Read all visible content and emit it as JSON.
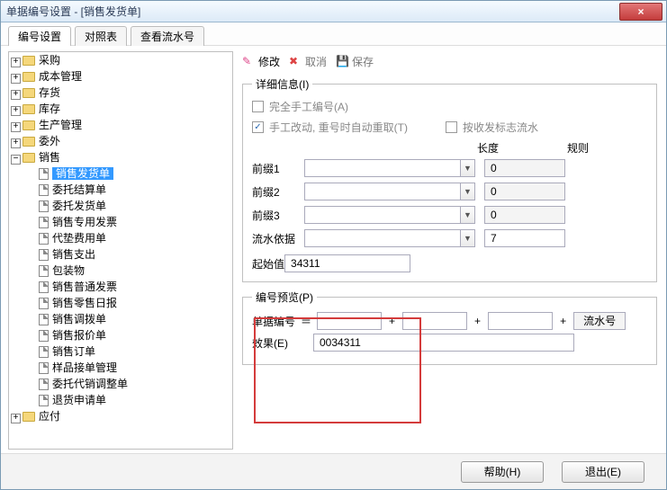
{
  "window": {
    "title": "单据编号设置 - [销售发货单]"
  },
  "tabs": {
    "t0": "编号设置",
    "t1": "对照表",
    "t2": "查看流水号"
  },
  "tree": {
    "n0": "采购",
    "n1": "成本管理",
    "n2": "存货",
    "n3": "库存",
    "n4": "生产管理",
    "n5": "委外",
    "n6": "销售",
    "s0": "销售发货单",
    "s1": "委托结算单",
    "s2": "委托发货单",
    "s3": "销售专用发票",
    "s4": "代垫费用单",
    "s5": "销售支出",
    "s6": "包装物",
    "s7": "销售普通发票",
    "s8": "销售零售日报",
    "s9": "销售调拨单",
    "s10": "销售报价单",
    "s11": "销售订单",
    "s12": "样品接单管理",
    "s13": "委托代销调整单",
    "s14": "退货申请单",
    "n7": "应付"
  },
  "toolbar": {
    "modify": "修改",
    "cancel": "取消",
    "save": "保存"
  },
  "detail": {
    "legend": "详细信息(I)",
    "chk_manual": "完全手工编号(A)",
    "chk_reset": "手工改动, 重号时自动重取(T)",
    "chk_bymark": "按收发标志流水",
    "col_len": "长度",
    "col_rule": "规则",
    "prefix1": "前缀1",
    "prefix2": "前缀2",
    "prefix3": "前缀3",
    "seq_basis": "流水依据",
    "seq_len": "7",
    "len0": "0",
    "start_label": "起始值",
    "start_value": "34311"
  },
  "preview": {
    "legend": "编号预览(P)",
    "doc_no": "单据编号",
    "eq": "＝",
    "tail": "流水号",
    "result_label": "效果(E)",
    "result_value": "0034311"
  },
  "footer": {
    "help": "帮助(H)",
    "exit": "退出(E)"
  }
}
